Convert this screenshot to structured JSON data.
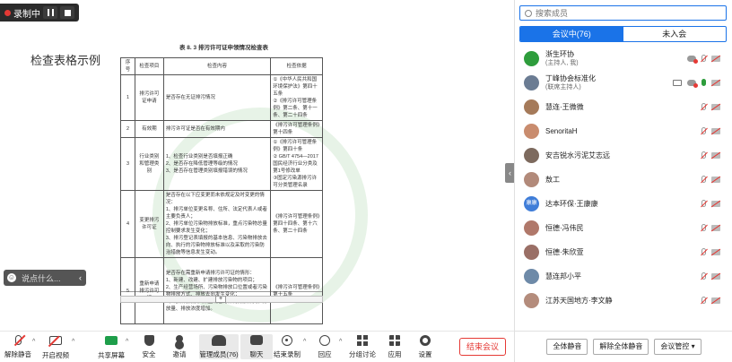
{
  "recording": {
    "label": "录制中"
  },
  "document": {
    "page_title": "检查表格示例",
    "table_caption": "表 8. 3  排污许可证申领情况检查表",
    "headers": [
      "序号",
      "检查项目",
      "检查内容",
      "检查依据"
    ],
    "rows": [
      {
        "no": "1",
        "item": "排污许可证申请",
        "content": "是否存在无证排污情况",
        "basis": "①《中华人民共和国环境保护法》第四十五条\n②《排污许可管理条例》第二条、第十一条、第二十四条"
      },
      {
        "no": "2",
        "item": "有效期",
        "content": "排污许可证是否在有效期内",
        "basis": "《排污许可管理条例》第十四条"
      },
      {
        "no": "3",
        "item": "行业类别和管理类别",
        "content": "1、检查行业类别是否填报正确\n2、是否存在降低管理等级的情况\n3、是否存在管理类别填报错误的情况",
        "basis": "①《排污许可管理条例》第四十条\n② GB/T 4754—2017 国民经济行业分类及第1号修改单\n③固定污染源排污许可分类管理名录"
      },
      {
        "no": "4",
        "item": "变更排污许可证",
        "content": "是否存在以下应变更而未依规定及时变更的情况：\n1、排污单位变更名称、住所、法定代表人或者主要负责人；\n2、排污单位污染物排放标准，重点污染物总量控制要求发生变化；\n3、排污登记表填报的基本信息、污染物排放去向、执行的污染物排放标准以及采取的污染防治措施等信息发生变动。",
        "basis": "《排污许可管理条例》第四十四条、第十六条、第二十四条"
      },
      {
        "no": "5",
        "item": "重新申请排污许可证",
        "content": "是否存在需重新申请排污许可证的情形：\n1、新建、改建、扩建排放污染物的项目；\n2、生产经营场所、污染物排放口位置或者污染物排放方式、排放去向发生变化；\n3、污染物排放口数量或者污染物排放种类、排放量、排放浓度增加。",
        "basis": "《排污许可管理条例》第十五条"
      }
    ]
  },
  "chat_prompt": {
    "placeholder": "说点什么..."
  },
  "sidebar": {
    "search_placeholder": "搜索成员",
    "tab_in": "会议中(76)",
    "tab_out": "未入会",
    "participants": [
      {
        "name": "浙生环协",
        "sub": "(主持人, 我)",
        "color": "#2e9d3c"
      },
      {
        "name": "丁峰协会标准化",
        "sub": "(联席主持人)",
        "color": "#6b7c93"
      },
      {
        "name": "慧连·王微微",
        "sub": "",
        "color": "#a57a5a"
      },
      {
        "name": "SenoritaH",
        "sub": "",
        "color": "#c98c6e"
      },
      {
        "name": "安吉锐水污泥艾志远",
        "sub": "",
        "color": "#7d6a5e"
      },
      {
        "name": "敖工",
        "sub": "",
        "color": "#b28a7a"
      },
      {
        "name": "达本环保·王康康",
        "sub": "",
        "color": "#3f7dd8",
        "initials": "康康"
      },
      {
        "name": "恒德·冯伟民",
        "sub": "",
        "color": "#b0786a"
      },
      {
        "name": "恒德·朱欣萱",
        "sub": "",
        "color": "#9a6f66"
      },
      {
        "name": "慧连邦小平",
        "sub": "",
        "color": "#6e8aa8"
      },
      {
        "name": "江苏天国地方·李文静",
        "sub": "",
        "color": "#b48c7c"
      }
    ],
    "mute_all": "全体静音",
    "unmute_all": "解除全体静音",
    "meeting_control": "会议管控 ▾"
  },
  "toolbar": {
    "items": [
      {
        "name": "unmute",
        "label": "解除静音"
      },
      {
        "name": "start-video",
        "label": "开启视频"
      },
      {
        "name": "share-screen",
        "label": "共享屏幕"
      },
      {
        "name": "security",
        "label": "安全"
      },
      {
        "name": "invite",
        "label": "邀请"
      },
      {
        "name": "manage-members",
        "label": "管理成员(76)"
      },
      {
        "name": "chat",
        "label": "聊天"
      },
      {
        "name": "end-recording",
        "label": "结束录制"
      },
      {
        "name": "reaction",
        "label": "回应"
      },
      {
        "name": "breakout",
        "label": "分组讨论"
      },
      {
        "name": "apps",
        "label": "应用"
      },
      {
        "name": "settings",
        "label": "设置"
      }
    ],
    "end_meeting": "结束会议"
  }
}
